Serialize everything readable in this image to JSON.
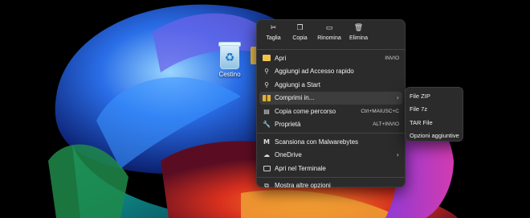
{
  "desktop": {
    "recycle_bin_label": "Cestino"
  },
  "context_menu": {
    "quick_actions": [
      {
        "label": "Taglia",
        "icon": "cut-icon"
      },
      {
        "label": "Copia",
        "icon": "copy-icon"
      },
      {
        "label": "Rinomina",
        "icon": "rename-icon"
      },
      {
        "label": "Elimina",
        "icon": "delete-icon"
      }
    ],
    "items": [
      {
        "label": "Apri",
        "shortcut": "INVIO",
        "icon": "folder-icon"
      },
      {
        "label": "Aggiungi ad Accesso rapido",
        "icon": "pin-icon"
      },
      {
        "label": "Aggiungi a Start",
        "icon": "pin-icon"
      },
      {
        "label": "Comprimi in...",
        "icon": "zip-icon",
        "has_submenu": true,
        "highlighted": true
      },
      {
        "label": "Copia come percorso",
        "shortcut": "Ctrl+MAIUSC+C",
        "icon": "copy-path-icon"
      },
      {
        "label": "Proprietà",
        "shortcut": "ALT+INVIO",
        "icon": "wrench-icon"
      },
      {
        "label": "Scansiona con Malwarebytes",
        "icon": "malwarebytes-icon"
      },
      {
        "label": "OneDrive",
        "icon": "onedrive-icon",
        "has_submenu": true
      },
      {
        "label": "Apri nel Terminale",
        "icon": "terminal-icon"
      },
      {
        "label": "Mostra altre opzioni",
        "icon": "more-options-icon"
      }
    ]
  },
  "submenu": {
    "items": [
      "File ZIP",
      "File 7z",
      "TAR File",
      "Opzioni aggiuntive"
    ]
  },
  "colors": {
    "menu_bg": "#2b2b2b",
    "highlight": "#3d3d3d",
    "accent": "#3b82f6"
  }
}
